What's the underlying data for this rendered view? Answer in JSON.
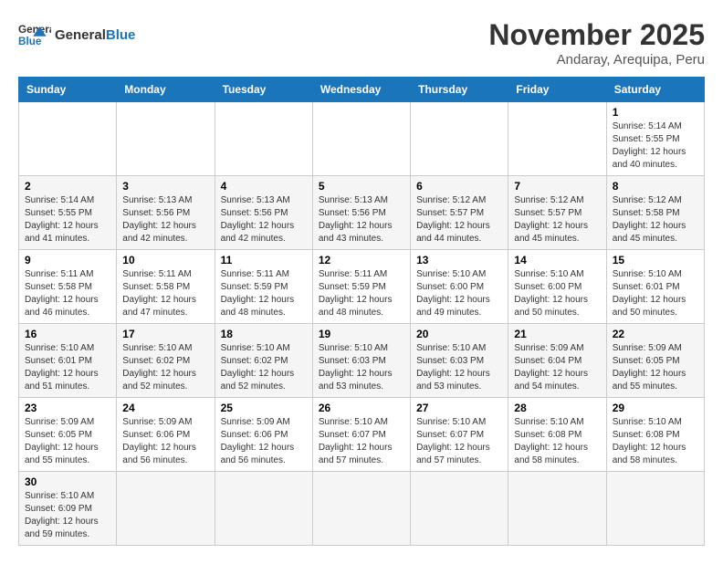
{
  "header": {
    "logo_general": "General",
    "logo_blue": "Blue",
    "title": "November 2025",
    "subtitle": "Andaray, Arequipa, Peru"
  },
  "weekdays": [
    "Sunday",
    "Monday",
    "Tuesday",
    "Wednesday",
    "Thursday",
    "Friday",
    "Saturday"
  ],
  "weeks": [
    [
      {
        "day": "",
        "info": ""
      },
      {
        "day": "",
        "info": ""
      },
      {
        "day": "",
        "info": ""
      },
      {
        "day": "",
        "info": ""
      },
      {
        "day": "",
        "info": ""
      },
      {
        "day": "",
        "info": ""
      },
      {
        "day": "1",
        "info": "Sunrise: 5:14 AM\nSunset: 5:55 PM\nDaylight: 12 hours and 40 minutes."
      }
    ],
    [
      {
        "day": "2",
        "info": "Sunrise: 5:14 AM\nSunset: 5:55 PM\nDaylight: 12 hours and 41 minutes."
      },
      {
        "day": "3",
        "info": "Sunrise: 5:13 AM\nSunset: 5:56 PM\nDaylight: 12 hours and 42 minutes."
      },
      {
        "day": "4",
        "info": "Sunrise: 5:13 AM\nSunset: 5:56 PM\nDaylight: 12 hours and 42 minutes."
      },
      {
        "day": "5",
        "info": "Sunrise: 5:13 AM\nSunset: 5:56 PM\nDaylight: 12 hours and 43 minutes."
      },
      {
        "day": "6",
        "info": "Sunrise: 5:12 AM\nSunset: 5:57 PM\nDaylight: 12 hours and 44 minutes."
      },
      {
        "day": "7",
        "info": "Sunrise: 5:12 AM\nSunset: 5:57 PM\nDaylight: 12 hours and 45 minutes."
      },
      {
        "day": "8",
        "info": "Sunrise: 5:12 AM\nSunset: 5:58 PM\nDaylight: 12 hours and 45 minutes."
      }
    ],
    [
      {
        "day": "9",
        "info": "Sunrise: 5:11 AM\nSunset: 5:58 PM\nDaylight: 12 hours and 46 minutes."
      },
      {
        "day": "10",
        "info": "Sunrise: 5:11 AM\nSunset: 5:58 PM\nDaylight: 12 hours and 47 minutes."
      },
      {
        "day": "11",
        "info": "Sunrise: 5:11 AM\nSunset: 5:59 PM\nDaylight: 12 hours and 48 minutes."
      },
      {
        "day": "12",
        "info": "Sunrise: 5:11 AM\nSunset: 5:59 PM\nDaylight: 12 hours and 48 minutes."
      },
      {
        "day": "13",
        "info": "Sunrise: 5:10 AM\nSunset: 6:00 PM\nDaylight: 12 hours and 49 minutes."
      },
      {
        "day": "14",
        "info": "Sunrise: 5:10 AM\nSunset: 6:00 PM\nDaylight: 12 hours and 50 minutes."
      },
      {
        "day": "15",
        "info": "Sunrise: 5:10 AM\nSunset: 6:01 PM\nDaylight: 12 hours and 50 minutes."
      }
    ],
    [
      {
        "day": "16",
        "info": "Sunrise: 5:10 AM\nSunset: 6:01 PM\nDaylight: 12 hours and 51 minutes."
      },
      {
        "day": "17",
        "info": "Sunrise: 5:10 AM\nSunset: 6:02 PM\nDaylight: 12 hours and 52 minutes."
      },
      {
        "day": "18",
        "info": "Sunrise: 5:10 AM\nSunset: 6:02 PM\nDaylight: 12 hours and 52 minutes."
      },
      {
        "day": "19",
        "info": "Sunrise: 5:10 AM\nSunset: 6:03 PM\nDaylight: 12 hours and 53 minutes."
      },
      {
        "day": "20",
        "info": "Sunrise: 5:10 AM\nSunset: 6:03 PM\nDaylight: 12 hours and 53 minutes."
      },
      {
        "day": "21",
        "info": "Sunrise: 5:09 AM\nSunset: 6:04 PM\nDaylight: 12 hours and 54 minutes."
      },
      {
        "day": "22",
        "info": "Sunrise: 5:09 AM\nSunset: 6:05 PM\nDaylight: 12 hours and 55 minutes."
      }
    ],
    [
      {
        "day": "23",
        "info": "Sunrise: 5:09 AM\nSunset: 6:05 PM\nDaylight: 12 hours and 55 minutes."
      },
      {
        "day": "24",
        "info": "Sunrise: 5:09 AM\nSunset: 6:06 PM\nDaylight: 12 hours and 56 minutes."
      },
      {
        "day": "25",
        "info": "Sunrise: 5:09 AM\nSunset: 6:06 PM\nDaylight: 12 hours and 56 minutes."
      },
      {
        "day": "26",
        "info": "Sunrise: 5:10 AM\nSunset: 6:07 PM\nDaylight: 12 hours and 57 minutes."
      },
      {
        "day": "27",
        "info": "Sunrise: 5:10 AM\nSunset: 6:07 PM\nDaylight: 12 hours and 57 minutes."
      },
      {
        "day": "28",
        "info": "Sunrise: 5:10 AM\nSunset: 6:08 PM\nDaylight: 12 hours and 58 minutes."
      },
      {
        "day": "29",
        "info": "Sunrise: 5:10 AM\nSunset: 6:08 PM\nDaylight: 12 hours and 58 minutes."
      }
    ],
    [
      {
        "day": "30",
        "info": "Sunrise: 5:10 AM\nSunset: 6:09 PM\nDaylight: 12 hours and 59 minutes."
      },
      {
        "day": "",
        "info": ""
      },
      {
        "day": "",
        "info": ""
      },
      {
        "day": "",
        "info": ""
      },
      {
        "day": "",
        "info": ""
      },
      {
        "day": "",
        "info": ""
      },
      {
        "day": "",
        "info": ""
      }
    ]
  ]
}
